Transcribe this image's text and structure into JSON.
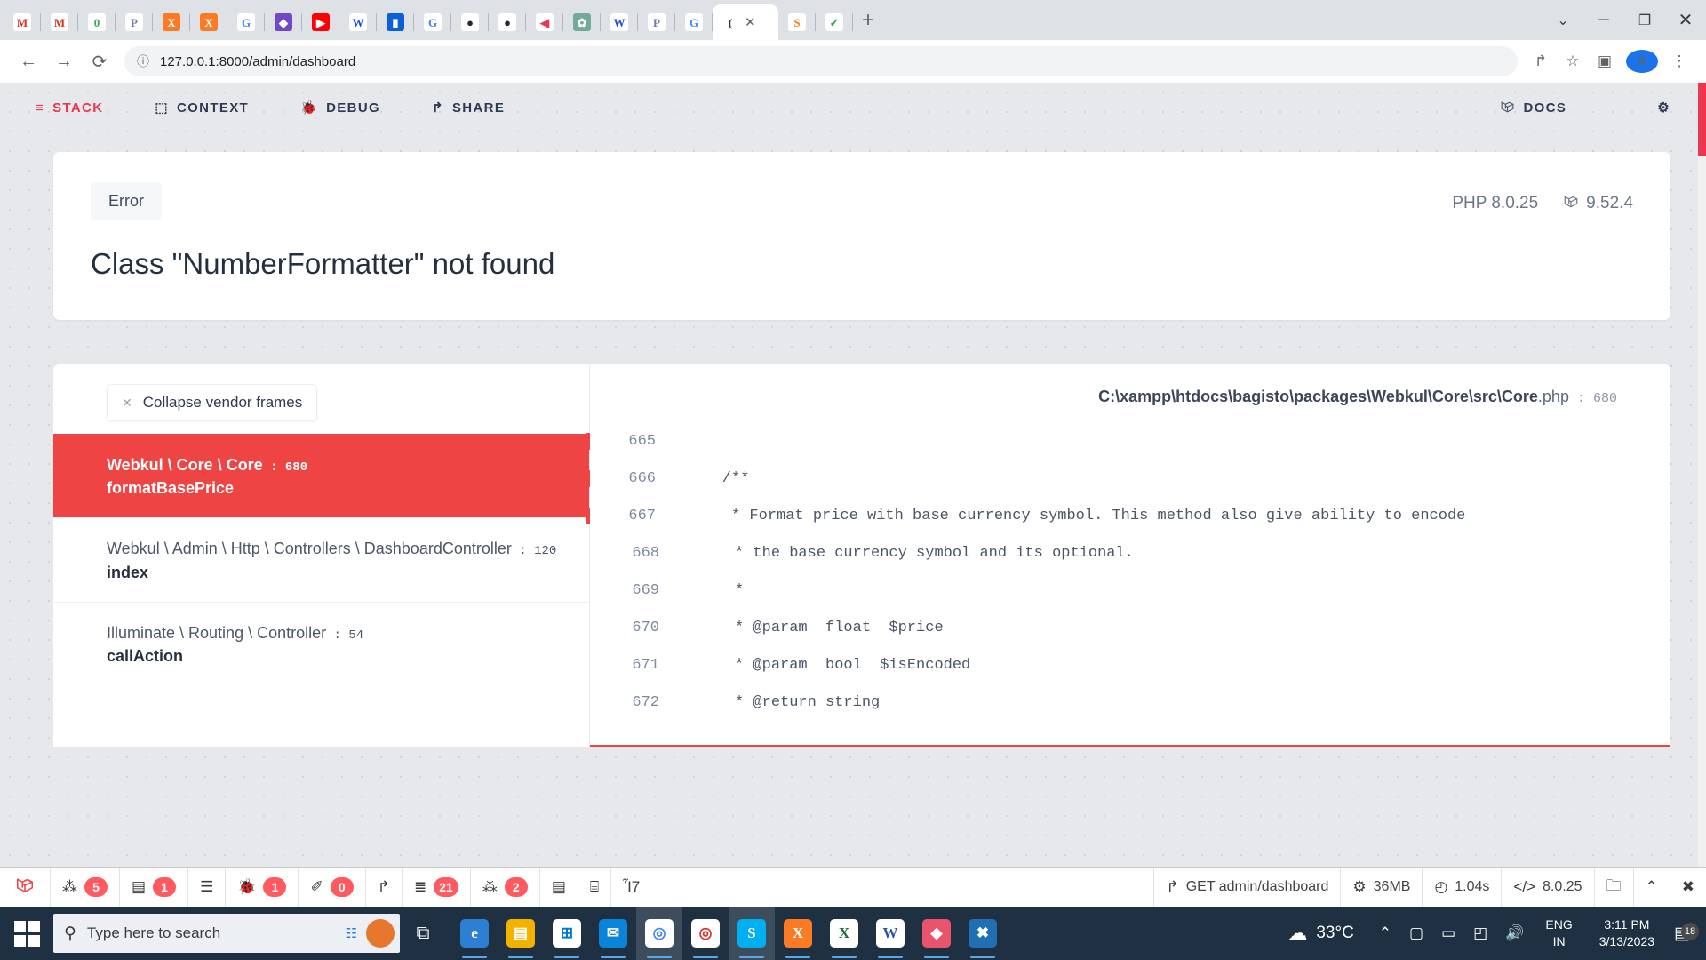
{
  "browser": {
    "tabs": [
      {
        "name": "gmail-tab",
        "glyph": "M",
        "bg": "#ffffff",
        "fg": "#d93025"
      },
      {
        "name": "gmail-tab-2",
        "glyph": "M",
        "bg": "#ffffff",
        "fg": "#d93025"
      },
      {
        "name": "adminer-tab",
        "glyph": "0",
        "bg": "#ffffff",
        "fg": "#34a853"
      },
      {
        "name": "phpmyadmin-tab",
        "glyph": "P",
        "bg": "#ffffff",
        "fg": "#6c78af"
      },
      {
        "name": "xampp-tab",
        "glyph": "X",
        "bg": "#fb7a24",
        "fg": "#ffffff"
      },
      {
        "name": "xampp-tab-2",
        "glyph": "X",
        "bg": "#fb7a24",
        "fg": "#ffffff"
      },
      {
        "name": "google-tab",
        "glyph": "G",
        "bg": "#ffffff",
        "fg": "#4285f4"
      },
      {
        "name": "laravel-news-tab",
        "glyph": "◆",
        "bg": "#7048c8",
        "fg": "#ffffff"
      },
      {
        "name": "youtube-tab",
        "glyph": "▶",
        "bg": "#ff0000",
        "fg": "#ffffff"
      },
      {
        "name": "webkul-tab",
        "glyph": "W",
        "bg": "#ffffff",
        "fg": "#1f4fd8"
      },
      {
        "name": "bagisto-tab",
        "glyph": "▮",
        "bg": "#0b60d8",
        "fg": "#ffffff"
      },
      {
        "name": "google-tab-2",
        "glyph": "G",
        "bg": "#ffffff",
        "fg": "#4285f4"
      },
      {
        "name": "github-tab",
        "glyph": "●",
        "bg": "#ffffff",
        "fg": "#24292f"
      },
      {
        "name": "github-tab-2",
        "glyph": "●",
        "bg": "#ffffff",
        "fg": "#24292f"
      },
      {
        "name": "laracasts-tab",
        "glyph": "◀",
        "bg": "#ffffff",
        "fg": "#e8384f"
      },
      {
        "name": "chatgpt-tab",
        "glyph": "✿",
        "bg": "#74aa9c",
        "fg": "#ffffff"
      },
      {
        "name": "webkul-tab-2",
        "glyph": "W",
        "bg": "#ffffff",
        "fg": "#1f4fd8"
      },
      {
        "name": "phpmyadmin-tab-2",
        "glyph": "P",
        "bg": "#ffffff",
        "fg": "#6c78af"
      },
      {
        "name": "google-tab-3",
        "glyph": "G",
        "bg": "#ffffff",
        "fg": "#4285f4"
      },
      {
        "name": "stackoverflow-tab",
        "glyph": "S",
        "bg": "#ffffff",
        "fg": "#f48024"
      },
      {
        "name": "check-tab",
        "glyph": "✓",
        "bg": "#ffffff",
        "fg": "#2aa44f"
      }
    ],
    "active_tab": {
      "name": "ignition-tab",
      "glyph": "(",
      "bg": "#ffffff",
      "fg": "#333333"
    },
    "tab_close_glyph": "✕",
    "new_tab_label": "+",
    "window_controls": {
      "dropdown": "⌄",
      "minimize": "─",
      "maximize": "❐",
      "close": "✕"
    },
    "nav": {
      "back": "←",
      "forward": "→",
      "reload": "⟳"
    },
    "omnibox": {
      "info_icon": "ⓘ",
      "url": "127.0.0.1:8000/admin/dashboard"
    },
    "toolbar_icons": {
      "share": "↱",
      "bookmark": "☆",
      "sidepanel": "▣",
      "menu": "⋮"
    },
    "profile_initial": "A"
  },
  "ignition": {
    "nav": {
      "items": [
        {
          "label": "STACK",
          "icon": "≡",
          "active": true
        },
        {
          "label": "CONTEXT",
          "icon": "⬚",
          "active": false
        },
        {
          "label": "DEBUG",
          "icon": "🐞",
          "active": false
        },
        {
          "label": "SHARE",
          "icon": "↱",
          "active": false
        }
      ],
      "docs_label": "DOCS",
      "docs_icon": "laravel-logo-icon",
      "settings_icon": "⚙"
    },
    "error": {
      "type_badge": "Error",
      "title": "Class \"NumberFormatter\" not found",
      "php_version": "PHP 8.0.25",
      "laravel_version": "9.52.4"
    },
    "frames": {
      "collapse_label": "Collapse vendor frames",
      "collapse_icon": "✕",
      "items": [
        {
          "path": "Webkul \\ Core \\ Core",
          "line": "680",
          "fn": "formatBasePrice",
          "active": true
        },
        {
          "path": "Webkul \\ Admin \\ Http \\ Controllers \\ DashboardController",
          "line": "120",
          "fn": "index",
          "active": false
        },
        {
          "path": "Illuminate \\ Routing \\ Controller",
          "line": "54",
          "fn": "callAction",
          "active": false
        }
      ]
    },
    "code": {
      "file_path": "C:\\xampp\\htdocs\\bagisto\\packages\\Webkul\\Core\\src\\Core",
      "file_ext": ".php",
      "file_line": "680",
      "lines": [
        {
          "n": "665",
          "text": "",
          "highlight": true
        },
        {
          "n": "666",
          "text": "    /**",
          "highlight": true
        },
        {
          "n": "667",
          "text": "     * Format price with base currency symbol. This method also give ability to encode",
          "highlight": true
        },
        {
          "n": "668",
          "text": "     * the base currency symbol and its optional.",
          "highlight": false
        },
        {
          "n": "669",
          "text": "     *",
          "highlight": false
        },
        {
          "n": "670",
          "text": "     * @param  float  $price",
          "highlight": false
        },
        {
          "n": "671",
          "text": "     * @param  bool  $isEncoded",
          "highlight": false
        },
        {
          "n": "672",
          "text": "     * @return string",
          "highlight": false
        }
      ]
    }
  },
  "debugbar": {
    "brand_icon": "laravel-logo-icon",
    "items": [
      {
        "name": "messages",
        "icon": "⁂",
        "badge": "5"
      },
      {
        "name": "views",
        "icon": "▤",
        "badge": "1"
      },
      {
        "name": "route",
        "icon": "☰",
        "badge": ""
      },
      {
        "name": "exceptions",
        "icon": "🐞",
        "badge": "1"
      },
      {
        "name": "mails",
        "icon": "✐",
        "badge": "0"
      },
      {
        "name": "request",
        "icon": "↱",
        "badge": ""
      },
      {
        "name": "queries",
        "icon": "≣",
        "badge": "21"
      },
      {
        "name": "models",
        "icon": "⁂",
        "badge": "2"
      },
      {
        "name": "session",
        "icon": "▤",
        "badge": ""
      },
      {
        "name": "cache",
        "icon": "⌸",
        "badge": ""
      },
      {
        "name": "labels",
        "icon": "Ἷ7",
        "badge": ""
      }
    ],
    "right": [
      {
        "name": "request-method",
        "icon": "↱",
        "label": "GET admin/dashboard"
      },
      {
        "name": "memory-usage",
        "icon": "⚙",
        "label": "36MB"
      },
      {
        "name": "request-duration",
        "icon": "◴",
        "label": "1.04s"
      },
      {
        "name": "php-version",
        "icon": "</>",
        "label": "8.0.25"
      },
      {
        "name": "open-storage",
        "icon": "🗀",
        "label": ""
      },
      {
        "name": "collapse-debugbar",
        "icon": "⌃",
        "label": ""
      },
      {
        "name": "close-debugbar",
        "icon": "✖",
        "label": ""
      }
    ]
  },
  "taskbar": {
    "start_label": "start-button",
    "search": {
      "icon": "⚲",
      "placeholder": "Type here to search"
    },
    "taskview_icon": "⧉",
    "apps": [
      {
        "name": "edge",
        "glyph": "e",
        "bg": "#2d7fd3",
        "running": true
      },
      {
        "name": "file-explorer",
        "glyph": "▤",
        "bg": "#f2b300",
        "running": true
      },
      {
        "name": "microsoft-store",
        "glyph": "⊞",
        "bg": "#ffffff",
        "fg": "#0078d4",
        "running": true
      },
      {
        "name": "mail",
        "glyph": "✉",
        "bg": "#0a84d8",
        "running": true
      },
      {
        "name": "chrome",
        "glyph": "◎",
        "bg": "#ffffff",
        "fg": "#4285f4",
        "running": true,
        "hot": true
      },
      {
        "name": "chrome-beta",
        "glyph": "◎",
        "bg": "#ffffff",
        "fg": "#d93025",
        "running": true
      },
      {
        "name": "skype",
        "glyph": "S",
        "bg": "#00aff0",
        "running": true,
        "hot": true
      },
      {
        "name": "xampp",
        "glyph": "X",
        "bg": "#fb7a24",
        "running": true
      },
      {
        "name": "excel",
        "glyph": "X",
        "bg": "#ffffff",
        "fg": "#1d6f42",
        "running": true
      },
      {
        "name": "word",
        "glyph": "W",
        "bg": "#ffffff",
        "fg": "#2b579a",
        "running": true
      },
      {
        "name": "affinity",
        "glyph": "◆",
        "bg": "#e8546b",
        "running": true
      },
      {
        "name": "vscode",
        "glyph": "✖",
        "bg": "#1f6fb2",
        "running": true
      }
    ],
    "tray": {
      "weather_icon": "☁",
      "temperature": "33°C",
      "overflow_icon": "⌃",
      "meet_icon": "▢",
      "battery_icon": "▭",
      "wifi_icon": "◰",
      "volume_icon": "🔊",
      "language_line1": "ENG",
      "language_line2": "IN",
      "time": "3:11 PM",
      "date": "3/13/2023",
      "notification_icon": "▤",
      "notification_count": "18"
    }
  }
}
